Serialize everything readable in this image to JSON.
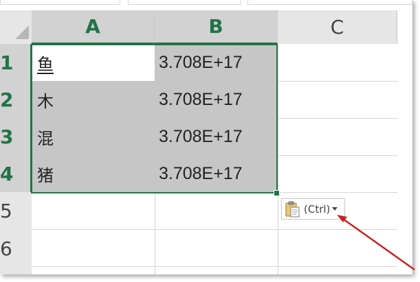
{
  "column_headers": [
    "A",
    "B",
    "C"
  ],
  "row_headers": [
    "1",
    "2",
    "3",
    "4",
    "5",
    "6"
  ],
  "rows": [
    {
      "a": "鱼",
      "b": "3.708E+17"
    },
    {
      "a": "木",
      "b": "3.708E+17"
    },
    {
      "a": "混",
      "b": "3.708E+17"
    },
    {
      "a": "猪",
      "b": "3.708E+17"
    }
  ],
  "paste_options": {
    "label": "(Ctrl)",
    "icon": "clipboard-paste-icon"
  },
  "colors": {
    "accent_green": "#217346",
    "selection_fill": "#c6c6c6",
    "annotation_red": "#cc1f1f"
  }
}
